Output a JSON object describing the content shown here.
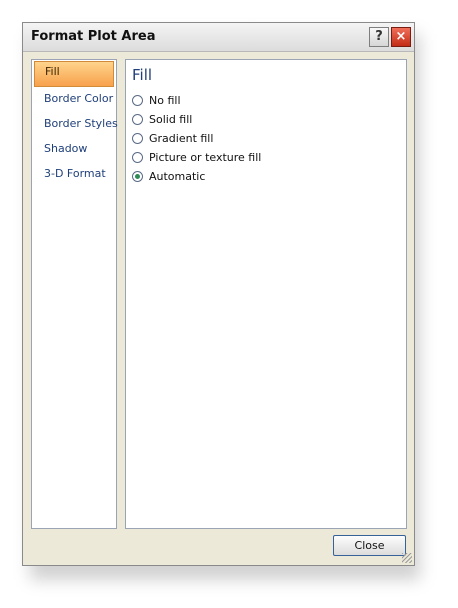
{
  "window": {
    "title": "Format Plot Area"
  },
  "titlebar": {
    "help_label": "?",
    "close_label": "×"
  },
  "sidebar": {
    "items": [
      {
        "label": "Fill",
        "selected": true
      },
      {
        "label": "Border Color"
      },
      {
        "label": "Border Styles"
      },
      {
        "label": "Shadow"
      },
      {
        "label": "3-D Format"
      }
    ]
  },
  "content": {
    "heading": "Fill",
    "options": [
      {
        "label": "No fill"
      },
      {
        "label": "Solid fill"
      },
      {
        "label": "Gradient fill"
      },
      {
        "label": "Picture or texture fill"
      },
      {
        "label": "Automatic",
        "checked": true
      }
    ]
  },
  "footer": {
    "close_label": "Close"
  }
}
